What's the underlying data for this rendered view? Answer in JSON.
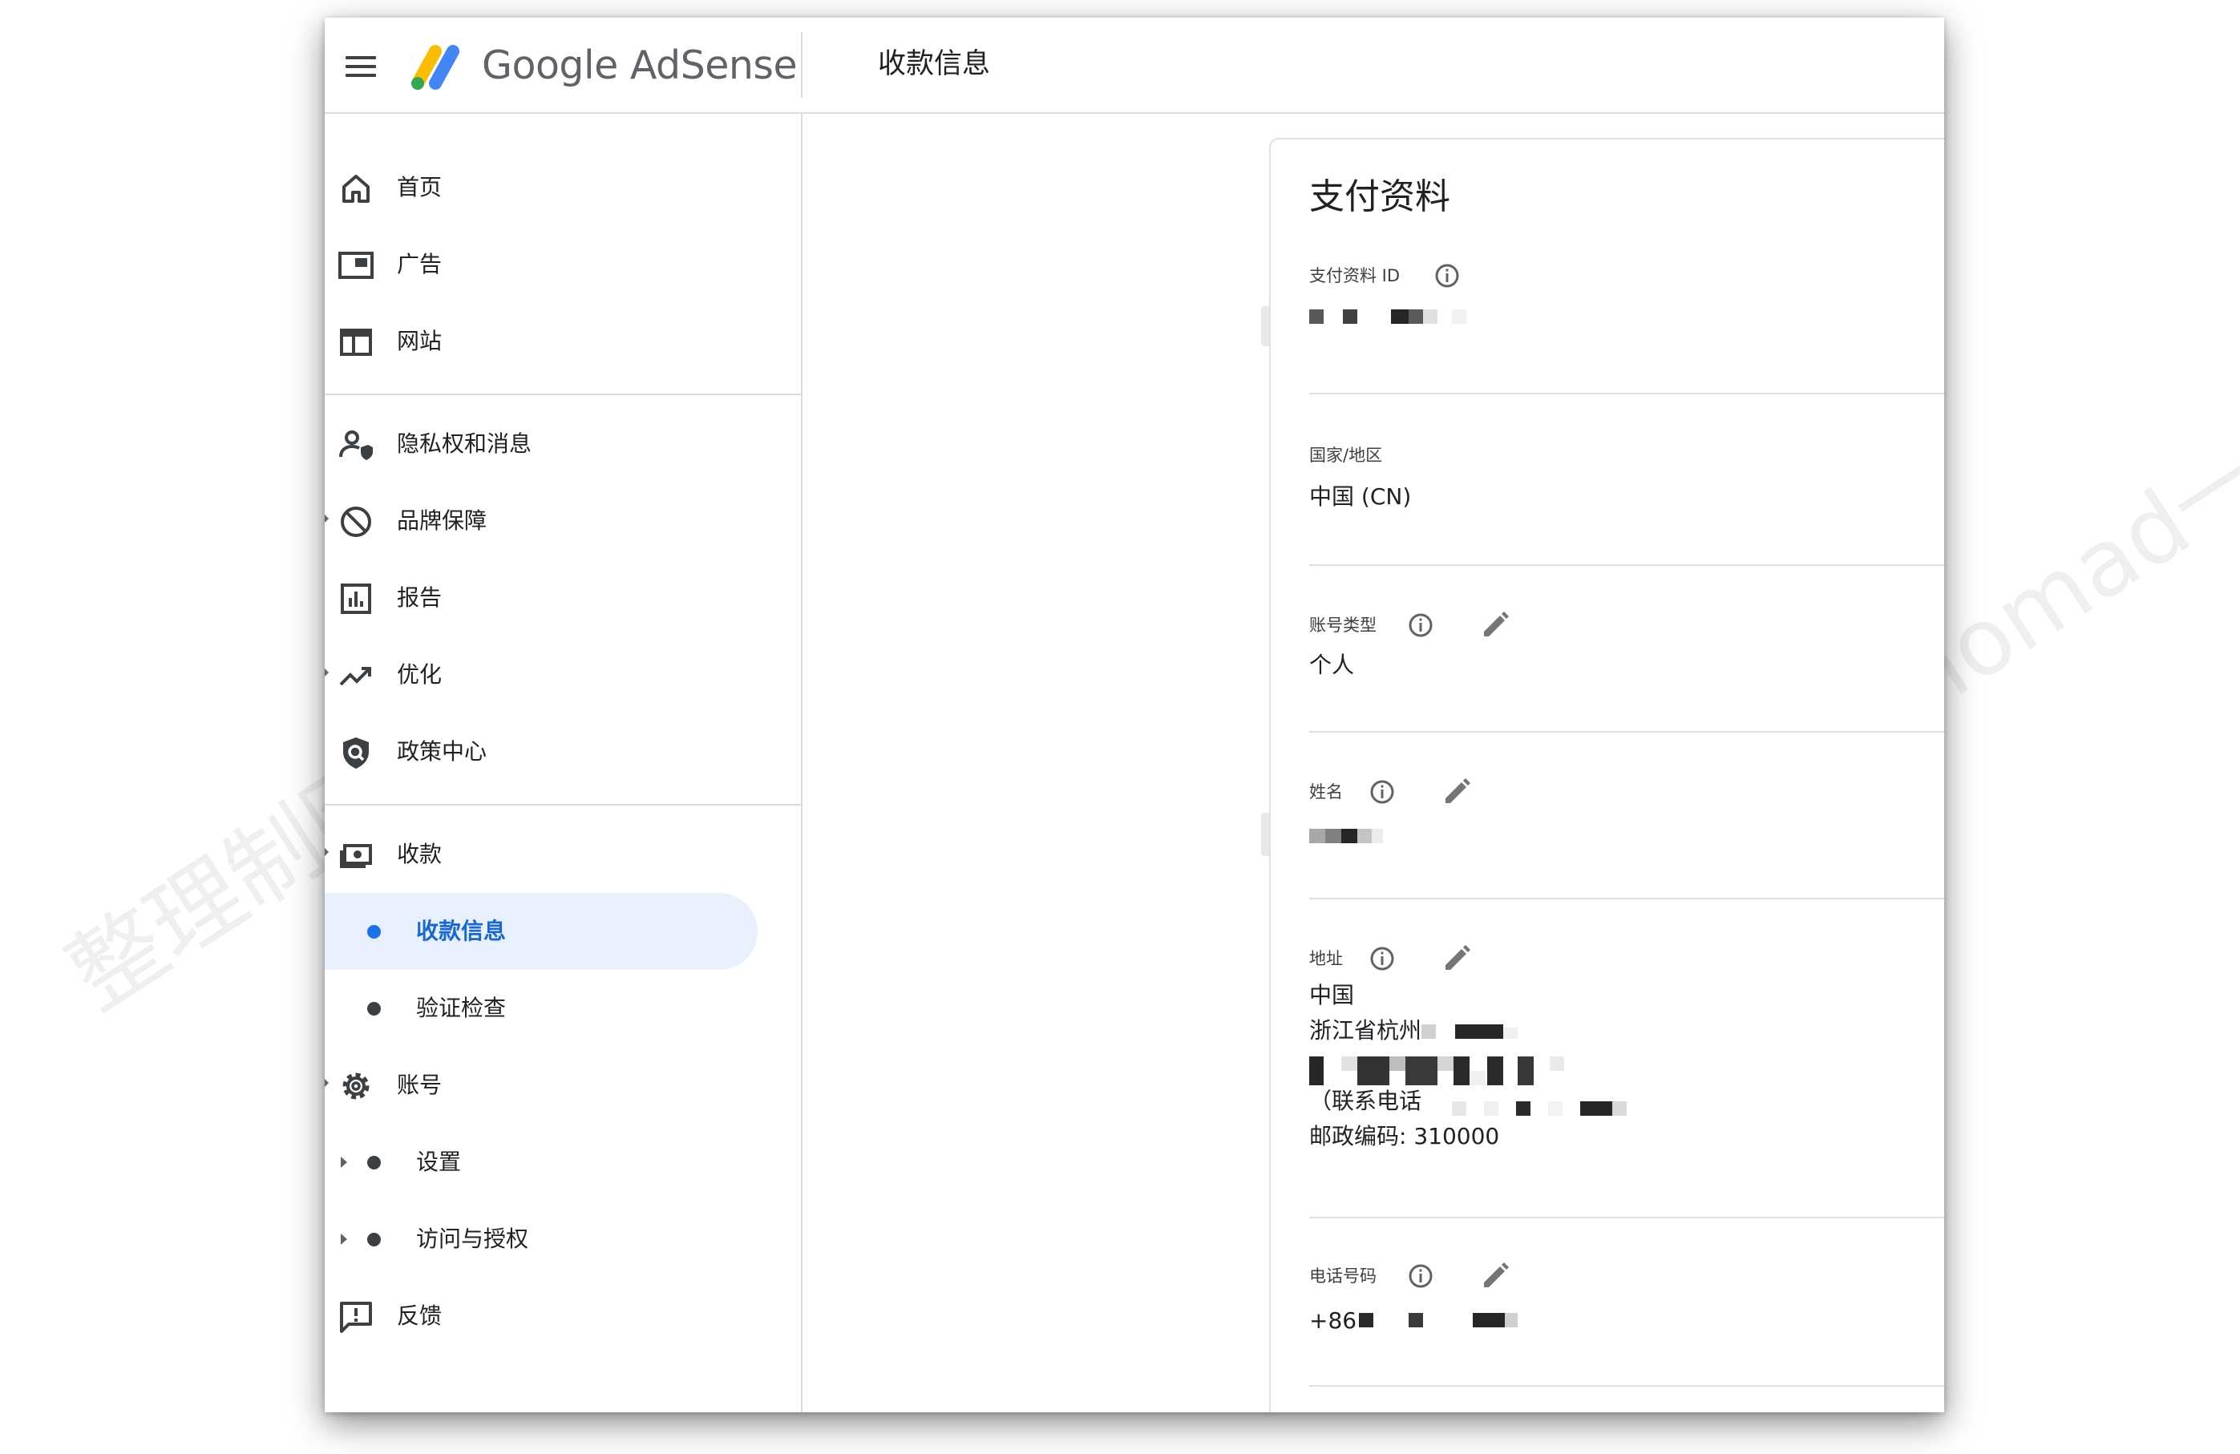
{
  "header": {
    "brand": "Google AdSense",
    "page_title": "收款信息"
  },
  "sidebar": {
    "items": [
      {
        "label": "首页",
        "icon": "home-icon"
      },
      {
        "label": "广告",
        "icon": "ads-icon"
      },
      {
        "label": "网站",
        "icon": "sites-icon"
      },
      {
        "label": "隐私权和消息",
        "icon": "privacy-icon"
      },
      {
        "label": "品牌保障",
        "icon": "block-icon"
      },
      {
        "label": "报告",
        "icon": "report-icon"
      },
      {
        "label": "优化",
        "icon": "trend-icon"
      },
      {
        "label": "政策中心",
        "icon": "policy-icon"
      },
      {
        "label": "收款",
        "icon": "payments-icon"
      },
      {
        "label": "收款信息",
        "active": true
      },
      {
        "label": "验证检查"
      },
      {
        "label": "账号",
        "icon": "gear-icon"
      },
      {
        "label": "设置"
      },
      {
        "label": "访问与授权"
      },
      {
        "label": "反馈",
        "icon": "feedback-icon"
      }
    ]
  },
  "profile": {
    "title": "支付资料",
    "fields": {
      "profile_id": {
        "label": "支付资料 ID",
        "value": ""
      },
      "country": {
        "label": "国家/地区",
        "value": "中国 (CN)"
      },
      "account_type": {
        "label": "账号类型",
        "value": "个人"
      },
      "name": {
        "label": "姓名",
        "value": ""
      },
      "address": {
        "label": "地址",
        "line1": "中国",
        "line2": "浙江省杭州",
        "line3": "",
        "line4": "（联系电话",
        "line5": "邮政编码: 310000"
      },
      "phone": {
        "label": "电话号码",
        "value": "+86"
      }
    }
  },
  "watermark": {
    "text": "整理制图：@Innomad一挪迈"
  },
  "colors": {
    "accent": "#1a73e8",
    "active_bg": "#e8f0fe",
    "divider": "#dadce0"
  }
}
